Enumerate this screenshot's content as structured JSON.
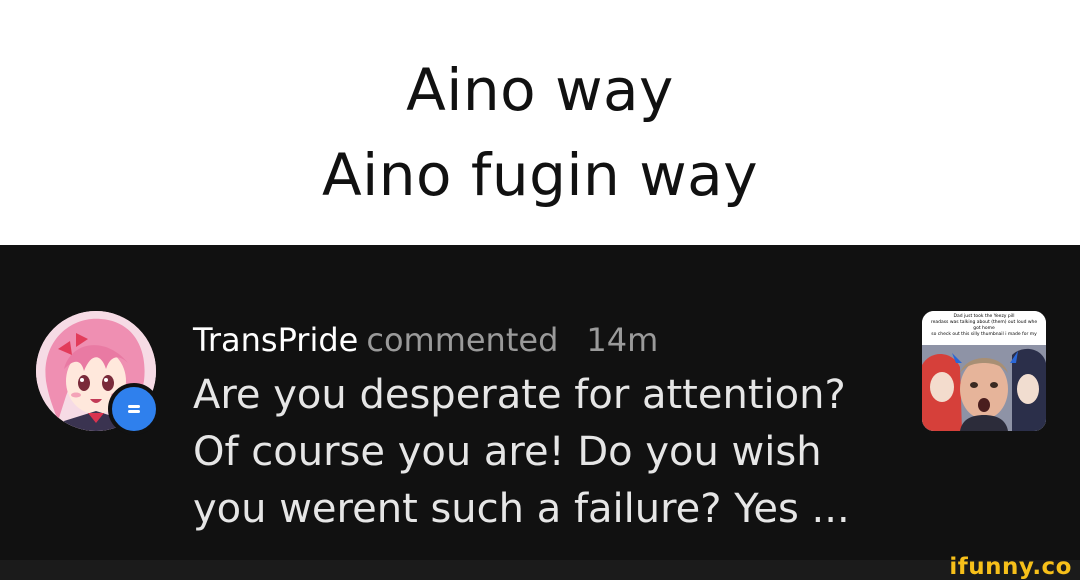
{
  "caption": {
    "line1": "Aino way",
    "line2": "Aino fugin way"
  },
  "notification": {
    "username": "TransPride",
    "action": "commented",
    "time": "14m",
    "body": "Are you desperate for attention?\nOf course you are! Do you wish\nyou werent such a failure? Yes ...",
    "avatar_icon": "anime-girl-avatar",
    "badge_icon": "chat-bubble-icon",
    "badge_color": "#2f80ed",
    "thumbnail": {
      "caption_lines": [
        "Dad just took the Yeezy pill",
        "readass was talking about (them) out loud whe",
        "got home",
        "so check out this silly thumbnail i made for my"
      ]
    }
  },
  "watermark": "ifunny.co",
  "colors": {
    "caption_bg": "#ffffff",
    "notification_bg": "#111111",
    "username": "#ffffff",
    "meta_gray": "#9a9a9a",
    "body_text": "#e6e6e6",
    "watermark": "#f7c01a"
  }
}
